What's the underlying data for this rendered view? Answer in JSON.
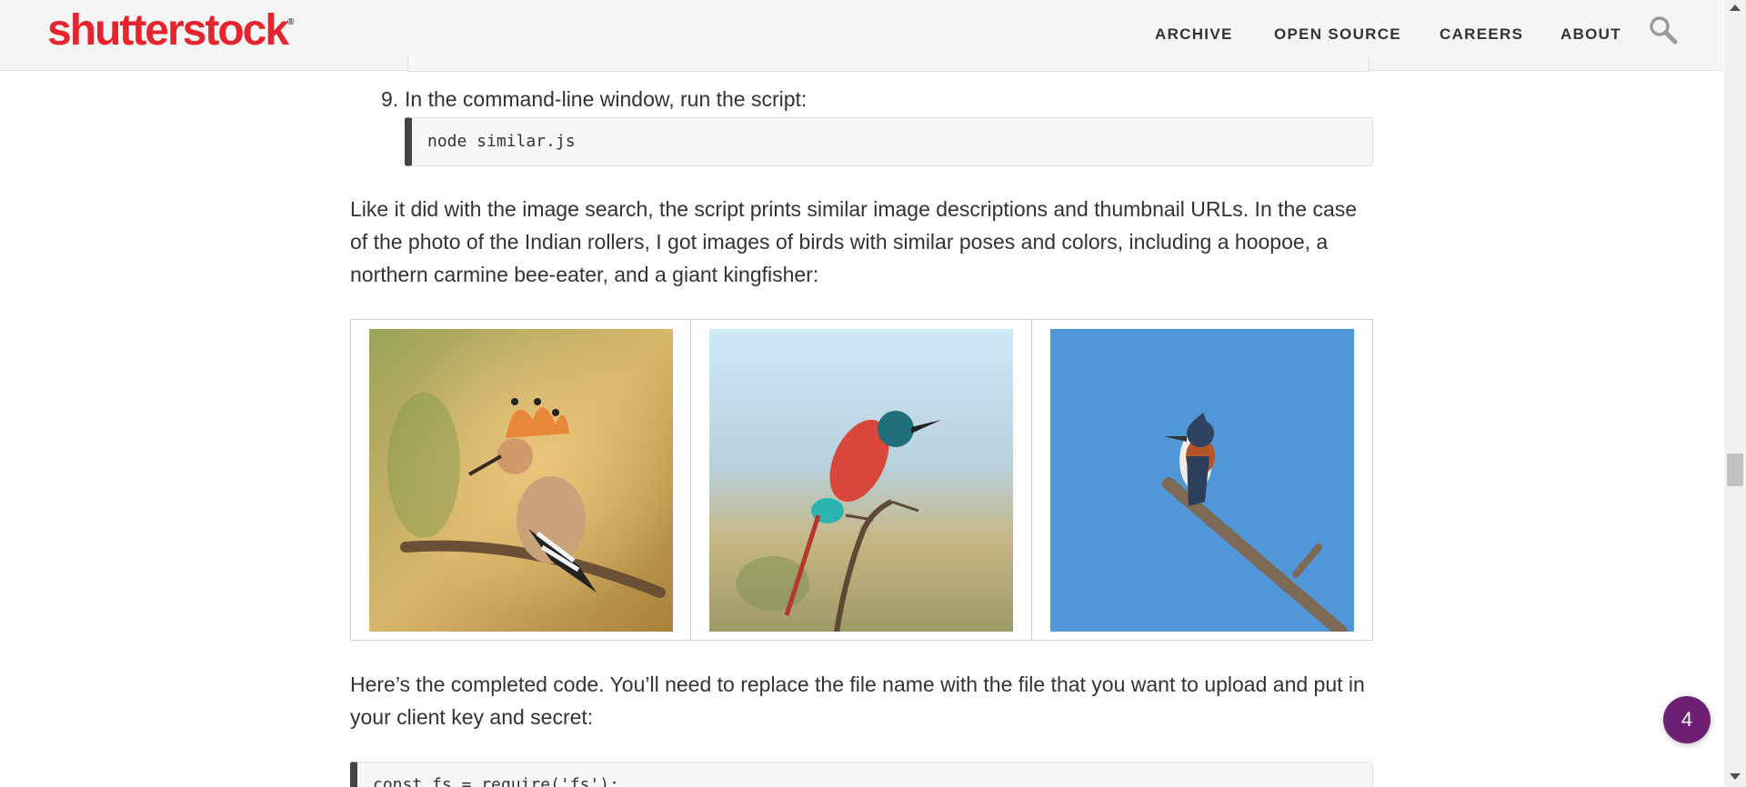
{
  "header": {
    "logo_text": "shutterstock",
    "nav": [
      {
        "label": "ARCHIVE"
      },
      {
        "label": "OPEN SOURCE"
      },
      {
        "label": "CAREERS"
      },
      {
        "label": "ABOUT"
      }
    ],
    "search_icon": "search-icon"
  },
  "article": {
    "step": {
      "number": "9.",
      "text": "In the command-line window, run the script:"
    },
    "code1": "node similar.js",
    "para1": "Like it did with the image search, the script prints similar image descriptions and thumbnail URLs. In the case of the photo of the Indian rollers, I got images of birds with similar poses and colors, including a hoopoe, a northern carmine bee-eater, and a giant kingfisher:",
    "para2": "Here’s the completed code. You’ll need to replace the file name with the file that you want to upload and put in your client key and secret:",
    "code2": "const fs = require('fs');"
  },
  "badge": {
    "count": "4"
  },
  "colors": {
    "brand": "#e6242e",
    "badge": "#6d1f73",
    "code_accent": "#444444"
  }
}
